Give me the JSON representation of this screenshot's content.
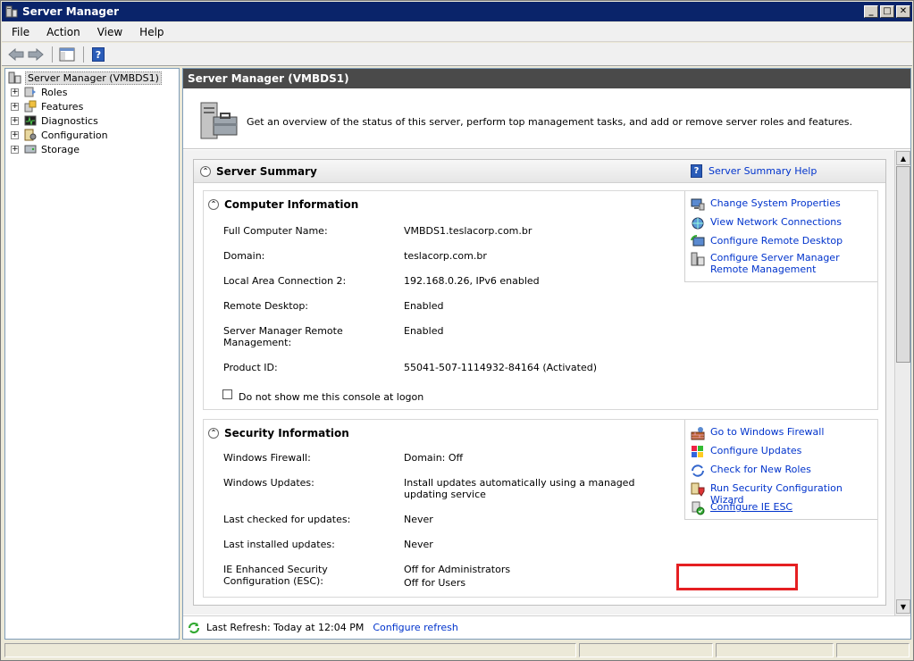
{
  "window": {
    "title": "Server Manager"
  },
  "menu": [
    "File",
    "Action",
    "View",
    "Help"
  ],
  "tree": {
    "root": "Server Manager (VMBDS1)",
    "items": [
      "Roles",
      "Features",
      "Diagnostics",
      "Configuration",
      "Storage"
    ]
  },
  "header": {
    "title": "Server Manager (VMBDS1)"
  },
  "overview": {
    "text": "Get an overview of the status of this server, perform top management tasks, and add or remove server roles and features."
  },
  "summary": {
    "title": "Server Summary",
    "help_link": "Server Summary Help",
    "computer": {
      "title": "Computer Information",
      "rows": [
        {
          "label": "Full Computer Name:",
          "value": "VMBDS1.teslacorp.com.br"
        },
        {
          "label": "Domain:",
          "value": "teslacorp.com.br"
        },
        {
          "label": "Local Area Connection 2:",
          "value": "192.168.0.26, IPv6 enabled"
        },
        {
          "label": "Remote Desktop:",
          "value": "Enabled"
        },
        {
          "label": "Server Manager Remote Management:",
          "value": "Enabled"
        },
        {
          "label": "Product ID:",
          "value": "55041-507-1114932-84164 (Activated)"
        }
      ],
      "checkbox_label": "Do not show me this console at logon",
      "checkbox_checked": false,
      "tasks": [
        {
          "label": "Change System Properties",
          "icon": "system-properties-icon"
        },
        {
          "label": "View Network Connections",
          "icon": "network-icon"
        },
        {
          "label": "Configure Remote Desktop",
          "icon": "remote-desktop-icon"
        },
        {
          "label": "Configure Server Manager Remote Management",
          "icon": "server-manager-icon"
        }
      ]
    },
    "security": {
      "title": "Security Information",
      "rows": [
        {
          "label": "Windows Firewall:",
          "value": "Domain: Off"
        },
        {
          "label": "Windows Updates:",
          "value": "Install updates automatically using a managed updating service"
        },
        {
          "label": "Last checked for updates:",
          "value": "Never"
        },
        {
          "label": "Last installed updates:",
          "value": "Never"
        },
        {
          "label": "IE Enhanced Security Configuration (ESC):",
          "value": "Off for Administrators",
          "value2": "Off for Users"
        }
      ],
      "tasks": [
        {
          "label": "Go to Windows Firewall",
          "icon": "firewall-icon"
        },
        {
          "label": "Configure Updates",
          "icon": "windows-update-icon"
        },
        {
          "label": "Check for New Roles",
          "icon": "roles-icon"
        },
        {
          "label": "Run Security Configuration Wizard",
          "icon": "security-wizard-icon"
        },
        {
          "label": "Configure IE ESC",
          "icon": "ie-esc-icon"
        }
      ]
    }
  },
  "status": {
    "last_refresh": "Last Refresh: Today at 12:04 PM",
    "configure_refresh": "Configure refresh"
  },
  "colors": {
    "highlight_box": "#e51f22",
    "title_bar": "#0a246a",
    "link": "#0033cc"
  }
}
